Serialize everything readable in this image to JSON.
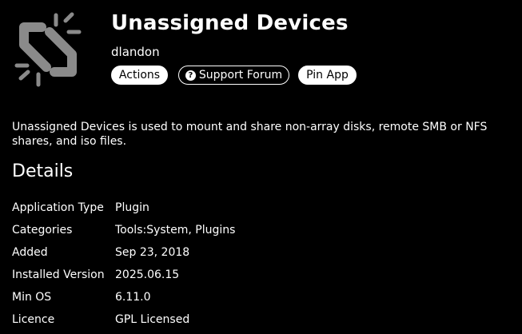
{
  "app": {
    "title": "Unassigned Devices",
    "author": "dlandon",
    "icon": "broken-chain-link-icon",
    "description": "Unassigned Devices is used to mount and share non-array disks, remote SMB or NFS shares, and iso files."
  },
  "buttons": {
    "actions": "Actions",
    "support_forum": "Support Forum",
    "pin_app": "Pin App",
    "support_icon": "question-circle-icon"
  },
  "details": {
    "heading": "Details",
    "rows": [
      {
        "label": "Application Type",
        "value": "Plugin"
      },
      {
        "label": "Categories",
        "value": "Tools:System, Plugins"
      },
      {
        "label": "Added",
        "value": "Sep 23, 2018"
      },
      {
        "label": "Installed Version",
        "value": "2025.06.15"
      },
      {
        "label": "Min OS",
        "value": "6.11.0"
      },
      {
        "label": "Licence",
        "value": "GPL Licensed"
      }
    ]
  },
  "colors": {
    "background": "#000000",
    "text": "#ffffff",
    "logo": "#8a8a8a"
  }
}
